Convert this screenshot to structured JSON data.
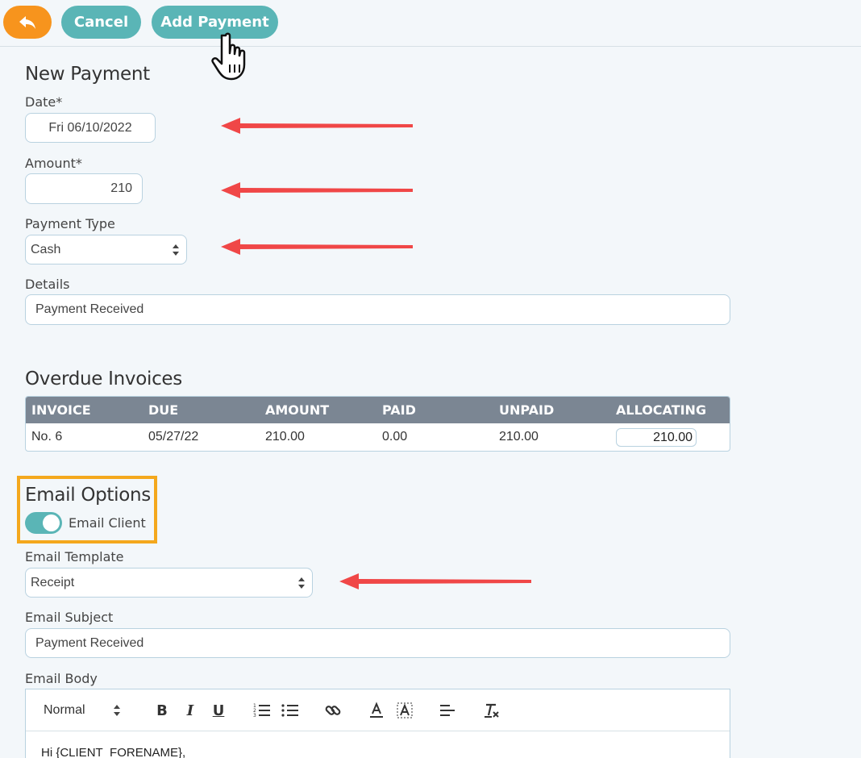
{
  "toolbar": {
    "back_icon": "undo-arrow-icon",
    "cancel_label": "Cancel",
    "add_label": "Add Payment"
  },
  "new_payment": {
    "heading": "New Payment",
    "date_label": "Date*",
    "date_value": "Fri 06/10/2022",
    "amount_label": "Amount*",
    "amount_value": "210",
    "type_label": "Payment Type",
    "type_value": "Cash",
    "details_label": "Details",
    "details_value": "Payment Received"
  },
  "invoices": {
    "heading": "Overdue Invoices",
    "columns": [
      "INVOICE",
      "DUE",
      "AMOUNT",
      "PAID",
      "UNPAID",
      "ALLOCATING"
    ],
    "rows": [
      {
        "invoice": "No. 6",
        "due": "05/27/22",
        "amount": "210.00",
        "paid": "0.00",
        "unpaid": "210.00",
        "allocating": "210.00"
      }
    ]
  },
  "email": {
    "heading": "Email Options",
    "toggle_label": "Email Client",
    "toggle_on": true,
    "template_label": "Email Template",
    "template_value": "Receipt",
    "subject_label": "Email Subject",
    "subject_value": "Payment Received",
    "body_label": "Email Body",
    "format_value": "Normal",
    "body_text": "Hi {CLIENT_FORENAME},"
  },
  "colors": {
    "accent": "#5ab5b6",
    "back_button": "#f7941d",
    "highlight": "#f4a81d",
    "annotation_arrow": "#f04747",
    "table_header": "#7b8693"
  }
}
